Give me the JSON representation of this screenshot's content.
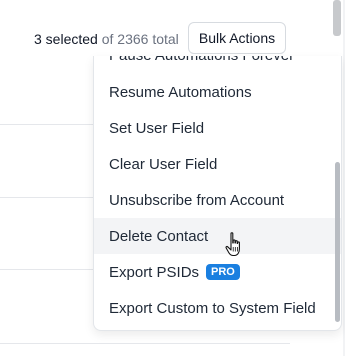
{
  "toolbar": {
    "selected_text": "3 selected",
    "total_text": " of 2366 total",
    "bulk_actions_label": "Bulk Actions"
  },
  "menu": {
    "partial_item": "Pause Automations Forever",
    "items": [
      {
        "label": "Resume Automations"
      },
      {
        "label": "Set User Field"
      },
      {
        "label": "Clear User Field"
      },
      {
        "label": "Unsubscribe from Account"
      },
      {
        "label": "Delete Contact"
      },
      {
        "label": "Export PSIDs",
        "badge": "PRO"
      },
      {
        "label": "Export Custom to System Field"
      }
    ],
    "hovered_item": "Delete Contact"
  },
  "icons": {
    "cursor": "hand-pointer-icon"
  },
  "colors": {
    "pro_badge": "#1a7fe0",
    "hover_row": "#f3f4f6"
  }
}
